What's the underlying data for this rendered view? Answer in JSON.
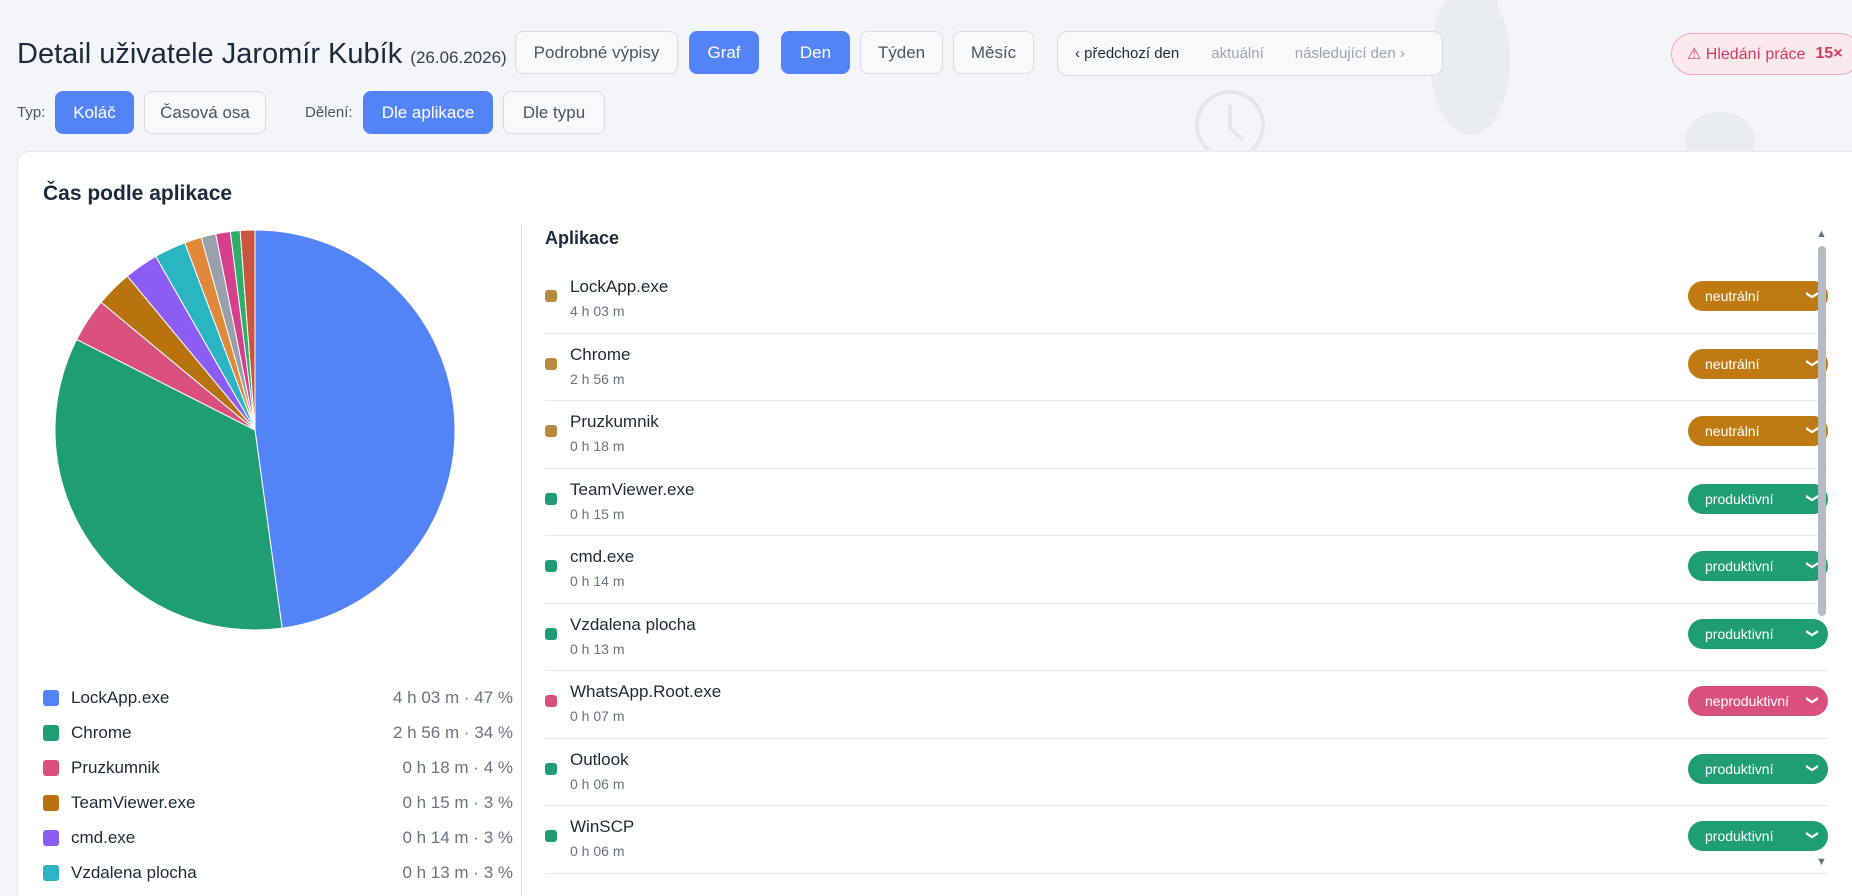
{
  "header": {
    "title": "Detail uživatele Jaromír Kubík",
    "date": "(26.06.2026)",
    "views": [
      {
        "label": "Podrobné výpisy",
        "active": false
      },
      {
        "label": "Graf",
        "active": true
      }
    ],
    "periods": [
      {
        "label": "Den",
        "active": true
      },
      {
        "label": "Týden",
        "active": false
      },
      {
        "label": "Měsíc",
        "active": false
      }
    ],
    "nav": {
      "prev": "‹ předchozí den",
      "current": "aktuální",
      "next": "následující den ›"
    },
    "alert": {
      "icon": "warning-icon",
      "label": "⚠ Hledání práce",
      "count": "15×"
    }
  },
  "filters": {
    "type_label": "Typ:",
    "types": [
      {
        "label": "Koláč",
        "active": true
      },
      {
        "label": "Časová osa",
        "active": false
      }
    ],
    "split_label": "Dělení:",
    "splits": [
      {
        "label": "Dle aplikace",
        "active": true
      },
      {
        "label": "Dle typu",
        "active": false
      }
    ]
  },
  "card": {
    "title": "Čas podle aplikace"
  },
  "legend": [
    {
      "name": "LockApp.exe",
      "value": "4 h 03 m · 47 %",
      "color": "#5283f7"
    },
    {
      "name": "Chrome",
      "value": "2 h 56 m · 34 %",
      "color": "#1f9e73"
    },
    {
      "name": "Pruzkumnik",
      "value": "0 h 18 m · 4 %",
      "color": "#d9507d"
    },
    {
      "name": "TeamViewer.exe",
      "value": "0 h 15 m · 3 %",
      "color": "#b8730f"
    },
    {
      "name": "cmd.exe",
      "value": "0 h 14 m · 3 %",
      "color": "#8b5cf6"
    },
    {
      "name": "Vzdalena plocha",
      "value": "0 h 13 m · 3 %",
      "color": "#2bb5c2"
    }
  ],
  "chart_data": {
    "type": "pie",
    "title": "Čas podle aplikace",
    "slices": [
      {
        "label": "LockApp.exe",
        "value": 243,
        "color": "#5283f7"
      },
      {
        "label": "Chrome",
        "value": 176,
        "color": "#1f9e73"
      },
      {
        "label": "Pruzkumnik",
        "value": 18,
        "color": "#d9507d"
      },
      {
        "label": "TeamViewer.exe",
        "value": 15,
        "color": "#b8730f"
      },
      {
        "label": "cmd.exe",
        "value": 14,
        "color": "#8b5cf6"
      },
      {
        "label": "Vzdalena plocha",
        "value": 13,
        "color": "#2bb5c2"
      },
      {
        "label": "WhatsApp.Root.exe",
        "value": 7,
        "color": "#e0893a"
      },
      {
        "label": "Outlook",
        "value": 6,
        "color": "#9aa0ab"
      },
      {
        "label": "WinSCP",
        "value": 6,
        "color": "#d63f8c"
      },
      {
        "label": "",
        "value": 4,
        "color": "#2fae6a"
      },
      {
        "label": "",
        "value": 6,
        "color": "#c9553d"
      }
    ]
  },
  "apps": {
    "heading": "Aplikace",
    "items": [
      {
        "name": "LockApp.exe",
        "time": "4 h 03 m",
        "dot": "#b8893f",
        "category": "neutrální",
        "cat_color": "#c07a12"
      },
      {
        "name": "Chrome",
        "time": "2 h 56 m",
        "dot": "#b8893f",
        "category": "neutrální",
        "cat_color": "#c07a12"
      },
      {
        "name": "Pruzkumnik",
        "time": "0 h 18 m",
        "dot": "#b8893f",
        "category": "neutrální",
        "cat_color": "#c07a12"
      },
      {
        "name": "TeamViewer.exe",
        "time": "0 h 15 m",
        "dot": "#1f9e73",
        "category": "produktivní",
        "cat_color": "#1f9e73"
      },
      {
        "name": "cmd.exe",
        "time": "0 h 14 m",
        "dot": "#1f9e73",
        "category": "produktivní",
        "cat_color": "#1f9e73"
      },
      {
        "name": "Vzdalena plocha",
        "time": "0 h 13 m",
        "dot": "#1f9e73",
        "category": "produktivní",
        "cat_color": "#1f9e73"
      },
      {
        "name": "WhatsApp.Root.exe",
        "time": "0 h 07 m",
        "dot": "#d9507d",
        "category": "neproduktivní",
        "cat_color": "#d9507d"
      },
      {
        "name": "Outlook",
        "time": "0 h 06 m",
        "dot": "#1f9e73",
        "category": "produktivní",
        "cat_color": "#1f9e73"
      },
      {
        "name": "WinSCP",
        "time": "0 h 06 m",
        "dot": "#1f9e73",
        "category": "produktivní",
        "cat_color": "#1f9e73"
      }
    ]
  }
}
